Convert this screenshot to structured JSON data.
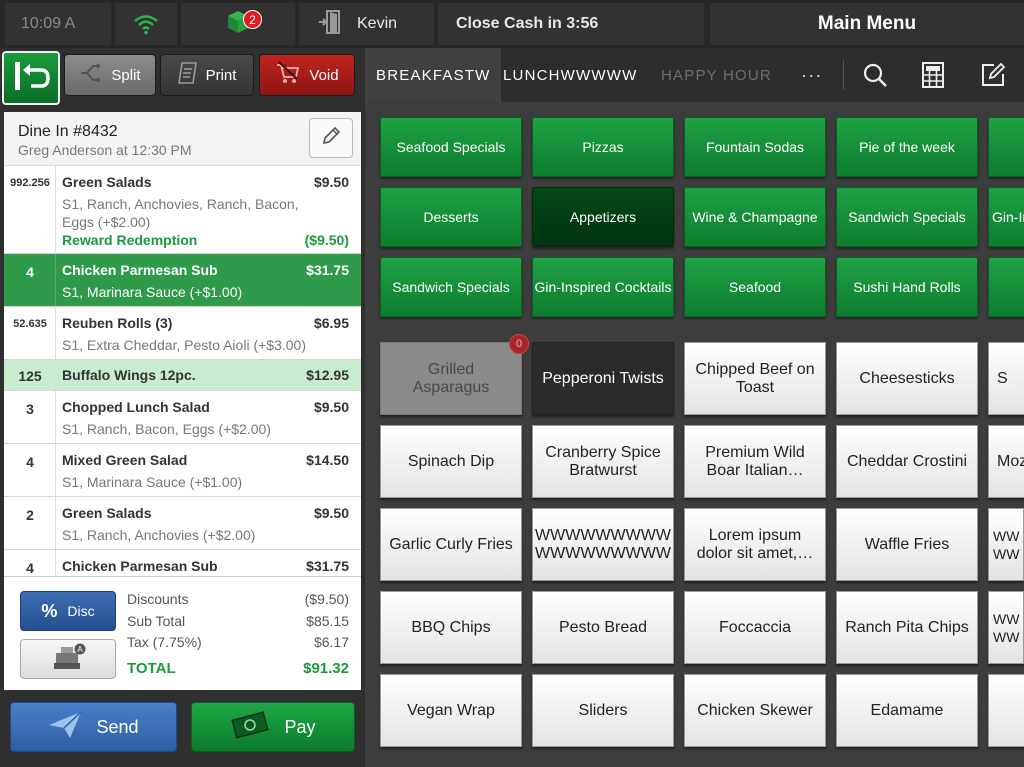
{
  "status_bar": {
    "time": "10:09 A",
    "order_badge": "2",
    "user": "Kevin",
    "close_cash": "Close Cash in 3:56",
    "main_menu": "Main Menu"
  },
  "actions": {
    "split": "Split",
    "print": "Print",
    "void": "Void"
  },
  "order": {
    "title": "Dine In #8432",
    "subtitle": "Greg Anderson at 12:30 PM"
  },
  "items": [
    {
      "qty": "992.256",
      "name": "Green Salads",
      "price": "$9.50",
      "mods": "S1, Ranch, Anchovies, Ranch, Bacon, Eggs (+$2.00)",
      "reward": "Reward Redemption",
      "reward_value": "($9.50)"
    },
    {
      "qty": "4",
      "name": "Chicken Parmesan Sub",
      "price": "$31.75",
      "mods": "S1, Marinara Sauce (+$1.00)"
    },
    {
      "qty": "52.635",
      "name": "Reuben Rolls (3)",
      "price": "$6.95",
      "mods": "S1, Extra Cheddar, Pesto Aioli (+$3.00)"
    },
    {
      "qty": "125",
      "name": "Buffalo Wings 12pc.",
      "price": "$12.95",
      "mods": ""
    },
    {
      "qty": "3",
      "name": "Chopped Lunch Salad",
      "price": "$9.50",
      "mods": "S1, Ranch, Bacon, Eggs (+$2.00)"
    },
    {
      "qty": "4",
      "name": "Mixed Green Salad",
      "price": "$14.50",
      "mods": "S1, Marinara Sauce (+$1.00)"
    },
    {
      "qty": "2",
      "name": "Green Salads",
      "price": "$9.50",
      "mods": "S1, Ranch, Anchovies (+$2.00)"
    },
    {
      "qty": "4",
      "name": "Chicken Parmesan Sub",
      "price": "$31.75",
      "mods": ""
    }
  ],
  "totals": {
    "disc_button": "Disc",
    "drawer_badge": "A",
    "discounts_label": "Discounts",
    "discounts": "($9.50)",
    "subtotal_label": "Sub Total",
    "subtotal": "$85.15",
    "tax_label": "Tax (7.75%)",
    "tax": "$6.17",
    "total_label": "TOTAL",
    "total": "$91.32"
  },
  "bottom": {
    "send": "Send",
    "pay": "Pay"
  },
  "menu_tabs": [
    "BREAKFASTW",
    "LUNCHWWWWW",
    "HAPPY HOUR"
  ],
  "more_label": "···",
  "categories": [
    [
      "Seafood Specials",
      "Pizzas",
      "Fountain Sodas",
      "Pie of the week",
      ""
    ],
    [
      "Desserts",
      "Appetizers",
      "Wine & Champagne",
      "Sandwich Specials",
      "Gin-In"
    ],
    [
      "Sandwich Specials",
      "Gin-Inspired Cocktails",
      "Seafood",
      "Sushi Hand Rolls",
      ""
    ]
  ],
  "products": [
    [
      "Grilled Asparagus",
      "Pepperoni Twists",
      "Chipped Beef on Toast",
      "Cheesesticks",
      "S"
    ],
    [
      "Spinach Dip",
      "Cranberry Spice Bratwurst",
      "Premium Wild Boar Italian…",
      "Cheddar Crostini",
      "Moz"
    ],
    [
      "Garlic Curly Fries",
      "WWWWWWWWW WWWWWWWWW",
      "Lorem ipsum dolor sit amet,…",
      "Waffle Fries",
      "WW WW"
    ],
    [
      "BBQ Chips",
      "Pesto Bread",
      "Foccaccia",
      "Ranch Pita Chips",
      "WW WW"
    ],
    [
      "Vegan Wrap",
      "Sliders",
      "Chicken Skewer",
      "Edamame",
      ""
    ]
  ],
  "product_badge": "0",
  "colors": {
    "accent_green": "#1ea145",
    "active_category": "#034a18",
    "send_blue": "#3d6db4",
    "void_red": "#c0231f"
  }
}
